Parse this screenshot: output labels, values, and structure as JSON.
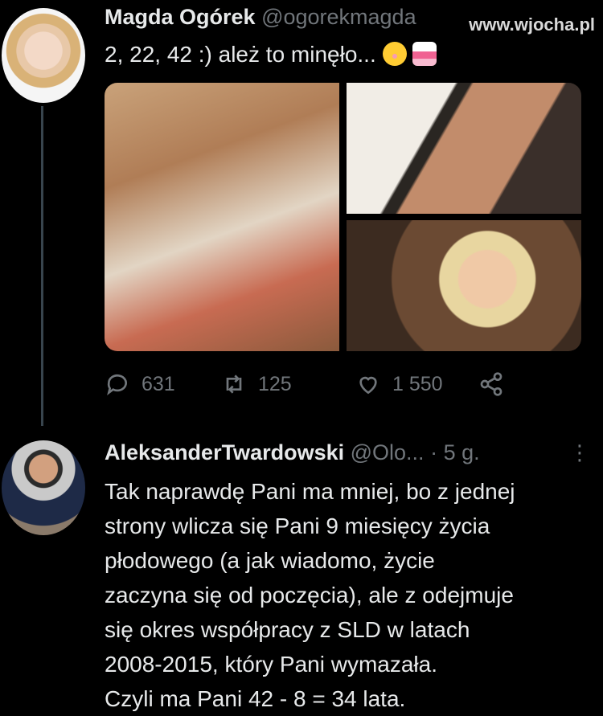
{
  "tweet": {
    "author_name": "Magda Ogórek",
    "author_handle": "@ogorekmagda",
    "text": "2,  22,  42 :) ależ to minęło...",
    "stats": {
      "replies": "631",
      "retweets": "125",
      "likes": "1 550"
    }
  },
  "watermark": "www.wjocha.pl",
  "reply": {
    "author_name": "AleksanderTwardowski",
    "author_handle": "@Olo...",
    "time": "· 5 g.",
    "lines": [
      "Tak naprawdę Pani ma mniej, bo z jednej",
      "strony wlicza się Pani 9 miesięcy życia",
      "płodowego (a jak wiadomo, życie",
      "zaczyna się od poczęcia), ale z odejmuje",
      "się okres współpracy z SLD w latach",
      "2008-2015, który Pani wymazała.",
      "Czyli ma Pani 42 - 8 = 34 lata."
    ]
  },
  "icons": {
    "reply": "reply-icon",
    "retweet": "retweet-icon",
    "like": "heart-icon",
    "share": "share-icon",
    "more": "more-icon"
  }
}
